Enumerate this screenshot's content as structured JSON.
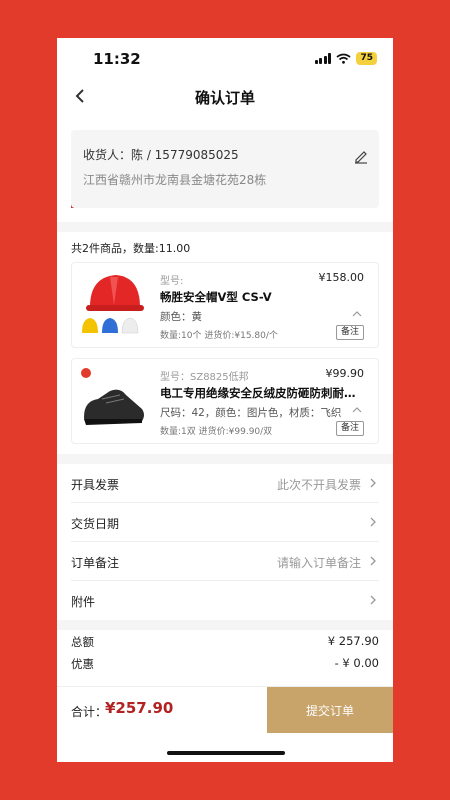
{
  "status": {
    "time": "11:32",
    "battery": "75"
  },
  "nav": {
    "title": "确认订单"
  },
  "address": {
    "line1": "收货人：陈 / 15779085025",
    "line2": "江西省赣州市龙南县金塘花苑28栋"
  },
  "summary": "共2件商品，数量:11.00",
  "goods": [
    {
      "model": "型号:",
      "price": "¥158.00",
      "name": "畅胜安全帽V型 CS-V",
      "spec": "颜色：黄",
      "qty": "数量:10个  进货价:¥15.80/个",
      "note": "备注",
      "image": "helmet"
    },
    {
      "model": "型号：SZ8825低邦",
      "price": "¥99.90",
      "name": "电工专用绝缘安全反绒皮防砸防刺耐磨劳保鞋",
      "spec": "尺码：42，颜色：图片色，材质：飞织",
      "qty": "数量:1双  进货价:¥99.90/双",
      "note": "备注",
      "image": "safety-shoe"
    }
  ],
  "rows": [
    {
      "label": "开具发票",
      "value": "此次不开具发票"
    },
    {
      "label": "交货日期",
      "value": ""
    },
    {
      "label": "订单备注",
      "value": "请输入订单备注"
    },
    {
      "label": "附件",
      "value": ""
    }
  ],
  "totals": [
    {
      "label": "总额",
      "value": "¥ 257.90"
    },
    {
      "label": "优惠",
      "value": "- ¥ 0.00"
    }
  ],
  "footer": {
    "total_label": "合计：",
    "total_amount": "¥257.90",
    "submit": "提交订单"
  },
  "colors": {
    "background": "#E23A2B",
    "price_red": "#B22222",
    "submit_bg": "#C8A36A"
  }
}
